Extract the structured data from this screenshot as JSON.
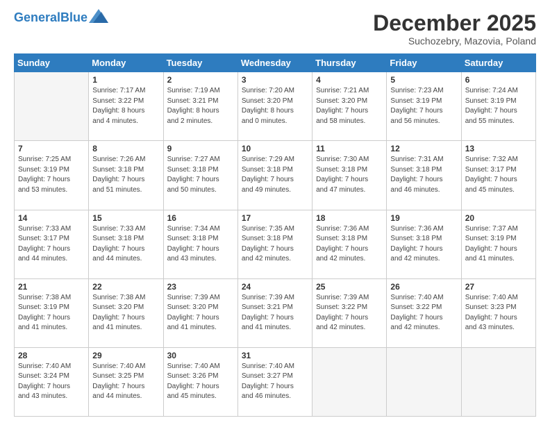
{
  "header": {
    "logo_line1": "General",
    "logo_line2": "Blue",
    "month": "December 2025",
    "location": "Suchozebry, Mazovia, Poland"
  },
  "days_of_week": [
    "Sunday",
    "Monday",
    "Tuesday",
    "Wednesday",
    "Thursday",
    "Friday",
    "Saturday"
  ],
  "weeks": [
    [
      {
        "num": "",
        "info": ""
      },
      {
        "num": "1",
        "info": "Sunrise: 7:17 AM\nSunset: 3:22 PM\nDaylight: 8 hours\nand 4 minutes."
      },
      {
        "num": "2",
        "info": "Sunrise: 7:19 AM\nSunset: 3:21 PM\nDaylight: 8 hours\nand 2 minutes."
      },
      {
        "num": "3",
        "info": "Sunrise: 7:20 AM\nSunset: 3:20 PM\nDaylight: 8 hours\nand 0 minutes."
      },
      {
        "num": "4",
        "info": "Sunrise: 7:21 AM\nSunset: 3:20 PM\nDaylight: 7 hours\nand 58 minutes."
      },
      {
        "num": "5",
        "info": "Sunrise: 7:23 AM\nSunset: 3:19 PM\nDaylight: 7 hours\nand 56 minutes."
      },
      {
        "num": "6",
        "info": "Sunrise: 7:24 AM\nSunset: 3:19 PM\nDaylight: 7 hours\nand 55 minutes."
      }
    ],
    [
      {
        "num": "7",
        "info": "Sunrise: 7:25 AM\nSunset: 3:19 PM\nDaylight: 7 hours\nand 53 minutes."
      },
      {
        "num": "8",
        "info": "Sunrise: 7:26 AM\nSunset: 3:18 PM\nDaylight: 7 hours\nand 51 minutes."
      },
      {
        "num": "9",
        "info": "Sunrise: 7:27 AM\nSunset: 3:18 PM\nDaylight: 7 hours\nand 50 minutes."
      },
      {
        "num": "10",
        "info": "Sunrise: 7:29 AM\nSunset: 3:18 PM\nDaylight: 7 hours\nand 49 minutes."
      },
      {
        "num": "11",
        "info": "Sunrise: 7:30 AM\nSunset: 3:18 PM\nDaylight: 7 hours\nand 47 minutes."
      },
      {
        "num": "12",
        "info": "Sunrise: 7:31 AM\nSunset: 3:18 PM\nDaylight: 7 hours\nand 46 minutes."
      },
      {
        "num": "13",
        "info": "Sunrise: 7:32 AM\nSunset: 3:17 PM\nDaylight: 7 hours\nand 45 minutes."
      }
    ],
    [
      {
        "num": "14",
        "info": "Sunrise: 7:33 AM\nSunset: 3:17 PM\nDaylight: 7 hours\nand 44 minutes."
      },
      {
        "num": "15",
        "info": "Sunrise: 7:33 AM\nSunset: 3:18 PM\nDaylight: 7 hours\nand 44 minutes."
      },
      {
        "num": "16",
        "info": "Sunrise: 7:34 AM\nSunset: 3:18 PM\nDaylight: 7 hours\nand 43 minutes."
      },
      {
        "num": "17",
        "info": "Sunrise: 7:35 AM\nSunset: 3:18 PM\nDaylight: 7 hours\nand 42 minutes."
      },
      {
        "num": "18",
        "info": "Sunrise: 7:36 AM\nSunset: 3:18 PM\nDaylight: 7 hours\nand 42 minutes."
      },
      {
        "num": "19",
        "info": "Sunrise: 7:36 AM\nSunset: 3:18 PM\nDaylight: 7 hours\nand 42 minutes."
      },
      {
        "num": "20",
        "info": "Sunrise: 7:37 AM\nSunset: 3:19 PM\nDaylight: 7 hours\nand 41 minutes."
      }
    ],
    [
      {
        "num": "21",
        "info": "Sunrise: 7:38 AM\nSunset: 3:19 PM\nDaylight: 7 hours\nand 41 minutes."
      },
      {
        "num": "22",
        "info": "Sunrise: 7:38 AM\nSunset: 3:20 PM\nDaylight: 7 hours\nand 41 minutes."
      },
      {
        "num": "23",
        "info": "Sunrise: 7:39 AM\nSunset: 3:20 PM\nDaylight: 7 hours\nand 41 minutes."
      },
      {
        "num": "24",
        "info": "Sunrise: 7:39 AM\nSunset: 3:21 PM\nDaylight: 7 hours\nand 41 minutes."
      },
      {
        "num": "25",
        "info": "Sunrise: 7:39 AM\nSunset: 3:22 PM\nDaylight: 7 hours\nand 42 minutes."
      },
      {
        "num": "26",
        "info": "Sunrise: 7:40 AM\nSunset: 3:22 PM\nDaylight: 7 hours\nand 42 minutes."
      },
      {
        "num": "27",
        "info": "Sunrise: 7:40 AM\nSunset: 3:23 PM\nDaylight: 7 hours\nand 43 minutes."
      }
    ],
    [
      {
        "num": "28",
        "info": "Sunrise: 7:40 AM\nSunset: 3:24 PM\nDaylight: 7 hours\nand 43 minutes."
      },
      {
        "num": "29",
        "info": "Sunrise: 7:40 AM\nSunset: 3:25 PM\nDaylight: 7 hours\nand 44 minutes."
      },
      {
        "num": "30",
        "info": "Sunrise: 7:40 AM\nSunset: 3:26 PM\nDaylight: 7 hours\nand 45 minutes."
      },
      {
        "num": "31",
        "info": "Sunrise: 7:40 AM\nSunset: 3:27 PM\nDaylight: 7 hours\nand 46 minutes."
      },
      {
        "num": "",
        "info": ""
      },
      {
        "num": "",
        "info": ""
      },
      {
        "num": "",
        "info": ""
      }
    ]
  ]
}
